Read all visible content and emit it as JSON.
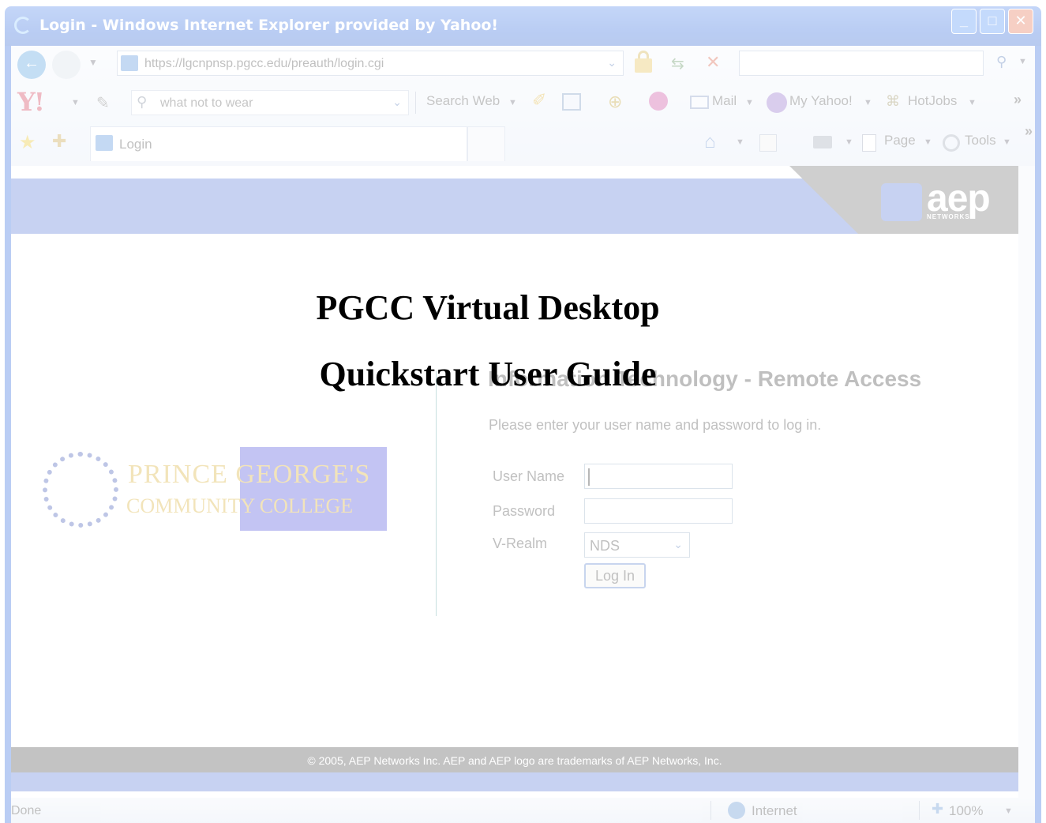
{
  "window": {
    "title": "Login - Windows Internet Explorer provided by Yahoo!",
    "minimize_glyph": "_",
    "maximize_glyph": "□",
    "close_glyph": "✕"
  },
  "address_bar": {
    "url": "https://lgcnpnsp.pgcc.edu/preauth/login.cgi",
    "search_value": ""
  },
  "yahoo_toolbar": {
    "logo": "Y!",
    "search_value": "what not to wear",
    "search_web_label": "Search Web",
    "mail_label": "Mail",
    "my_yahoo_label": "My Yahoo!",
    "hotjobs_label": "HotJobs",
    "more_glyph": "»"
  },
  "tabs": [
    {
      "label": "Login",
      "active": true
    }
  ],
  "command_bar": {
    "page_label": "Page",
    "tools_label": "Tools",
    "more_glyph": "»"
  },
  "page": {
    "brand": {
      "name": "aep",
      "sub": "NETWORKS"
    },
    "college_logo": {
      "line1": "PRINCE GEORGE'S",
      "line2": "COMMUNITY COLLEGE"
    },
    "heading": "Information Technology - Remote Access",
    "instructions": "Please enter your user name and password to log in.",
    "form": {
      "username_label": "User Name",
      "username_value": "",
      "password_label": "Password",
      "password_value": "",
      "realm_label": "V-Realm",
      "realm_value": "NDS",
      "login_button": "Log In"
    },
    "footer": "© 2005, AEP Networks Inc. AEP and AEP logo are trademarks of AEP Networks, Inc."
  },
  "status_bar": {
    "status": "Done",
    "zone": "Internet",
    "zoom": "100%"
  },
  "overlay": {
    "title_line1": "PGCC Virtual Desktop",
    "title_line2": "Quickstart User Guide"
  },
  "colors": {
    "titlebar": "#0a4fd8",
    "banner_blue": "#3b5fd3",
    "banner_grey": "#555555",
    "college_gold": "#d4a00a",
    "footer_dark": "#2d2d2d"
  }
}
